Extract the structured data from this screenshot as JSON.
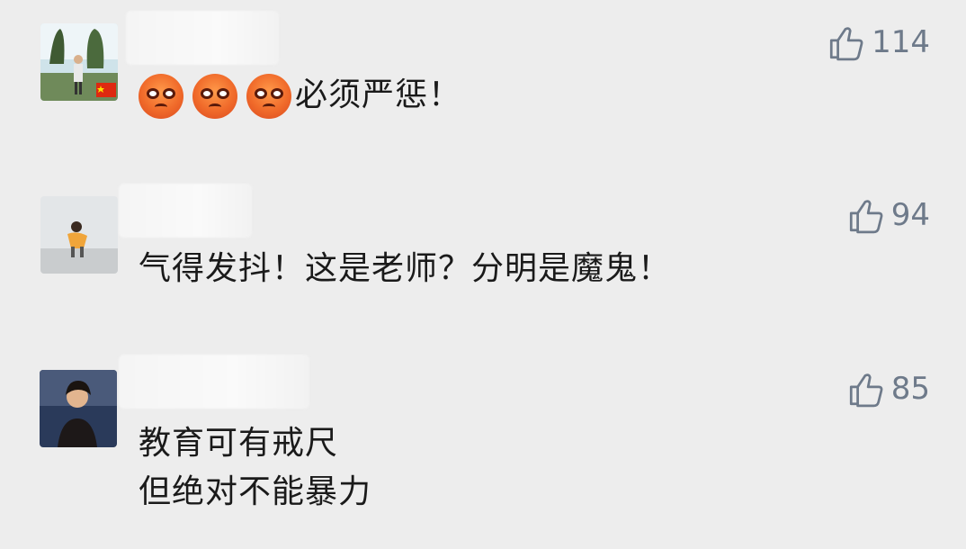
{
  "comments": [
    {
      "likes": "114",
      "text": "必须严惩！",
      "emoji_icon": "angry-face-icon",
      "emoji_count": 3
    },
    {
      "likes": "94",
      "text": "气得发抖！这是老师？分明是魔鬼！"
    },
    {
      "likes": "85",
      "text_line1": "教育可有戒尺",
      "text_line2": "但绝对不能暴力"
    }
  ],
  "icons": {
    "like": "thumbs-up-icon"
  },
  "colors": {
    "background": "#ededed",
    "like_text": "#6e7a8a",
    "comment_text": "#1a1a1a"
  }
}
